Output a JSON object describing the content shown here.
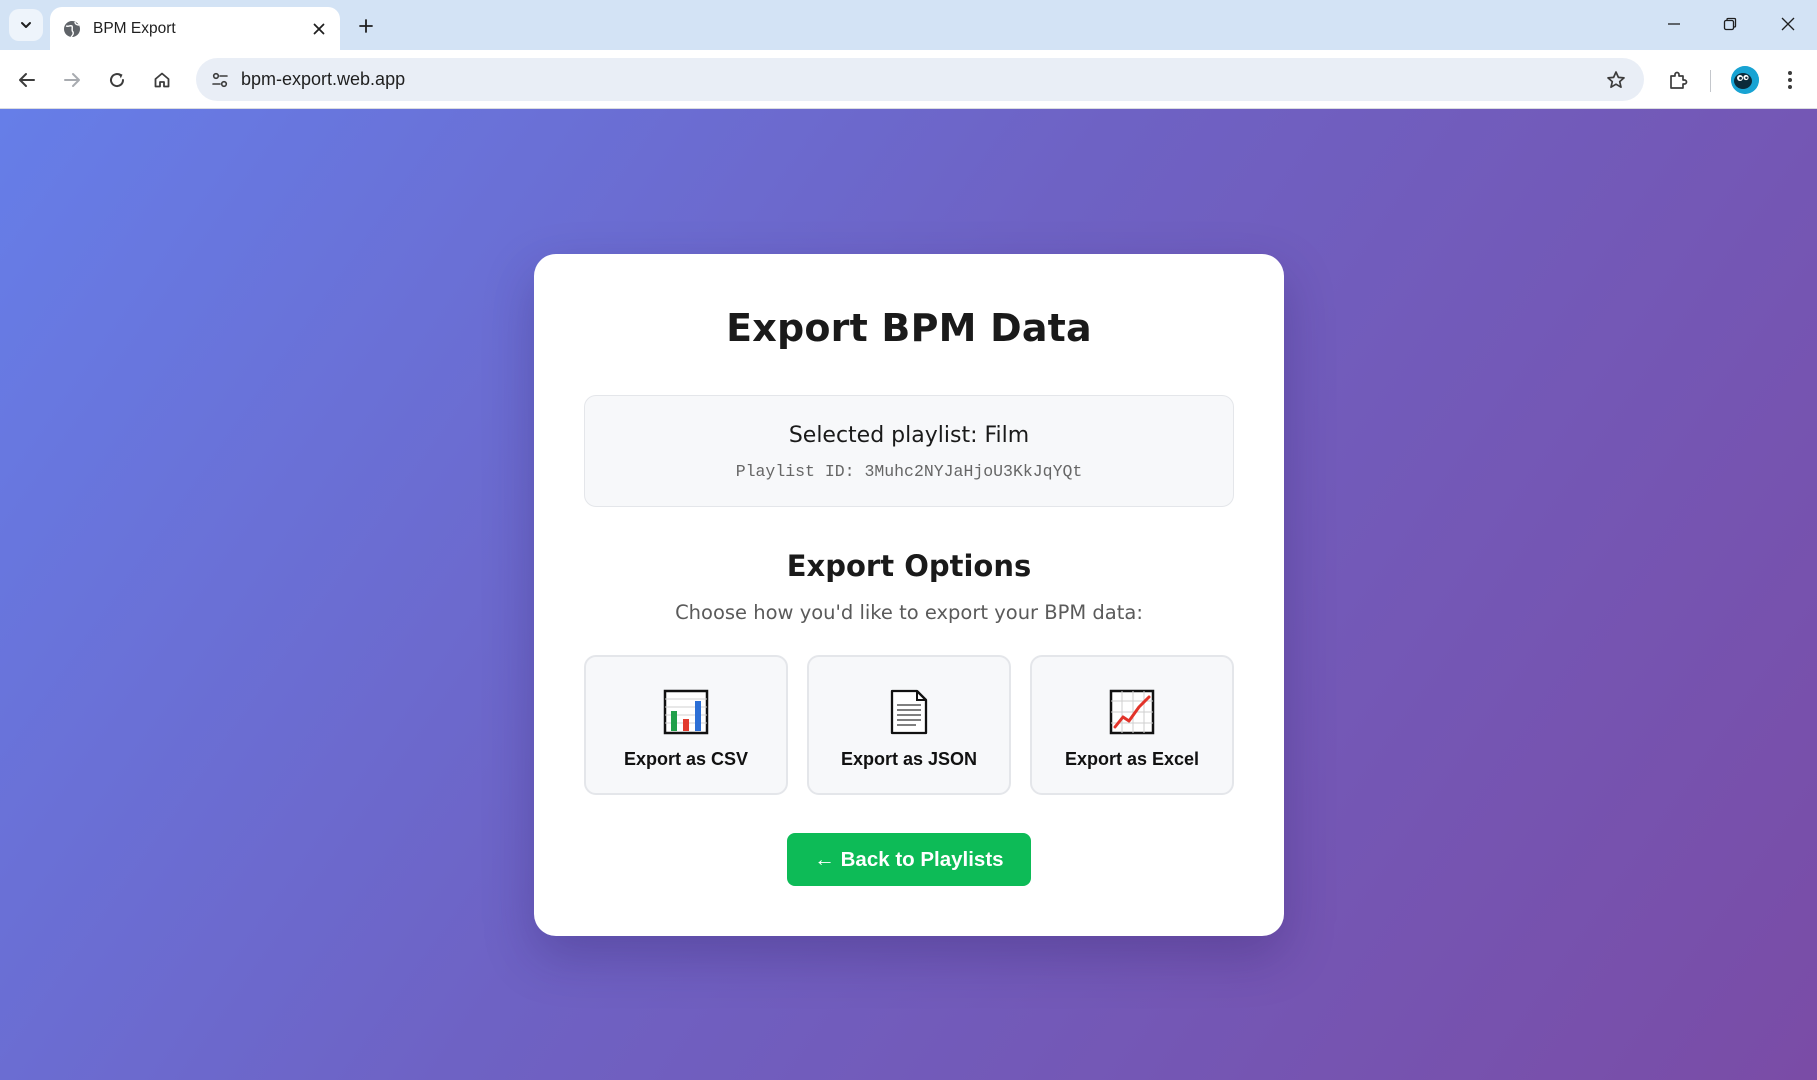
{
  "browser": {
    "tab_title": "BPM Export",
    "url": "bpm-export.web.app",
    "icons": {
      "tab_search": "chevron-down-icon",
      "favicon": "globe-icon",
      "tab_close": "close-icon",
      "new_tab": "plus-icon",
      "minimize": "minimize-icon",
      "restore": "restore-icon",
      "close_window": "close-icon",
      "back": "arrow-left-icon",
      "forward": "arrow-right-icon",
      "reload": "reload-icon",
      "home": "home-icon",
      "site_info": "tune-icon",
      "bookmark": "star-icon",
      "extensions": "puzzle-icon",
      "menu": "kebab-menu-icon"
    }
  },
  "page": {
    "title": "Export BPM Data",
    "playlist": {
      "name_text": "Selected playlist: Film",
      "id_text": "Playlist ID: 3Muhc2NYJaHjoU3KkJqYQt"
    },
    "export_section": {
      "title": "Export Options",
      "subtitle": "Choose how you'd like to export your BPM data:"
    },
    "options": [
      {
        "label": "Export as CSV",
        "icon": "bar-chart-icon"
      },
      {
        "label": "Export as JSON",
        "icon": "document-icon"
      },
      {
        "label": "Export as Excel",
        "icon": "line-chart-icon"
      }
    ],
    "back_button": "← Back to Playlists"
  },
  "colors": {
    "gradient_start": "#667ee8",
    "gradient_end": "#7a4ca6",
    "primary_button": "#0dbb57",
    "card_bg": "#ffffff"
  }
}
